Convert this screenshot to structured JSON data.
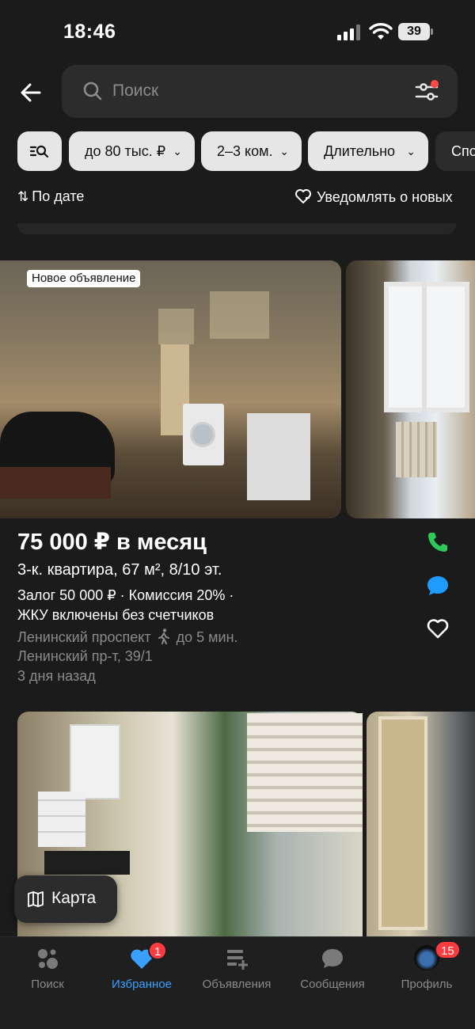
{
  "status_bar": {
    "time": "18:46",
    "battery": "39"
  },
  "search": {
    "placeholder": "Поиск"
  },
  "filters": {
    "chips": [
      {
        "label": "до 80 тыс. ₽"
      },
      {
        "label": "2–3 ком."
      },
      {
        "label": "Длительно"
      },
      {
        "label": "Спо"
      }
    ]
  },
  "sort": {
    "label": "По дате"
  },
  "notify": {
    "label": "Уведомлять о новых"
  },
  "listings": [
    {
      "badge": "Новое объявление",
      "price": "75 000 ₽ в месяц",
      "title": "3-к. квартира, 67 м², 8/10 эт.",
      "terms_line1": "Залог 50 000 ₽ · Комиссия 20% ·",
      "terms_line2": "ЖКУ включены без счетчиков",
      "metro": "Ленинский проспект",
      "metro_time": "до 5 мин.",
      "address": "Ленинский пр-т, 39/1",
      "date": "3 дня назад"
    }
  ],
  "map_button": {
    "label": "Карта"
  },
  "bottom_nav": {
    "items": [
      {
        "label": "Поиск"
      },
      {
        "label": "Избранное",
        "badge": "1"
      },
      {
        "label": "Объявления"
      },
      {
        "label": "Сообщения"
      },
      {
        "label": "Профиль",
        "badge": "15"
      }
    ]
  },
  "colors": {
    "background": "#1b1b1b",
    "accent_blue": "#3aa0ff",
    "call_green": "#2fc95a",
    "chat_blue": "#1f9bff",
    "badge_red": "#ff3b40"
  }
}
